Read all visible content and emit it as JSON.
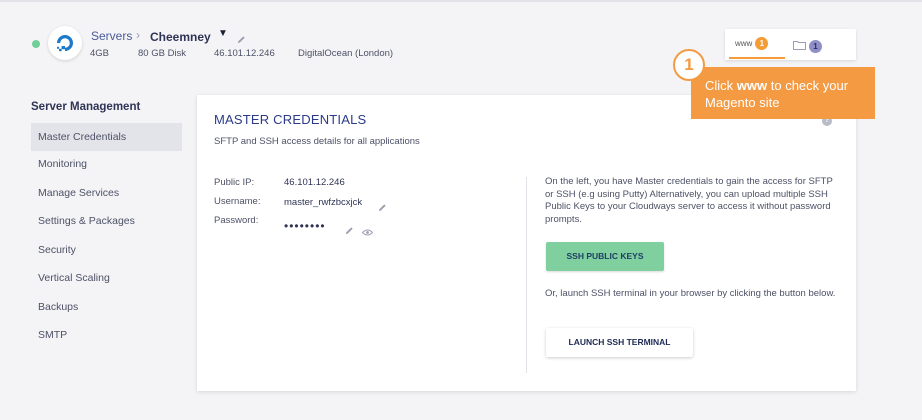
{
  "header": {
    "breadcrumb_root": "Servers",
    "breadcrumb_current": "Cheemney",
    "ram": "4GB",
    "disk": "80 GB Disk",
    "ip": "46.101.12.246",
    "provider": "DigitalOcean (London)",
    "status_color": "#6fcf97"
  },
  "quick_tabs": {
    "www_label": "www",
    "www_count": "1",
    "files_count": "1"
  },
  "callout": {
    "step": "1",
    "text_prefix": "Click ",
    "text_bold": "www",
    "text_suffix": " to check your Magento site"
  },
  "sidebar": {
    "title": "Server Management",
    "items": [
      {
        "label": "Master Credentials",
        "active": true
      },
      {
        "label": "Monitoring"
      },
      {
        "label": "Manage Services"
      },
      {
        "label": "Settings & Packages"
      },
      {
        "label": "Security"
      },
      {
        "label": "Vertical Scaling"
      },
      {
        "label": "Backups"
      },
      {
        "label": "SMTP"
      }
    ]
  },
  "card": {
    "title": "MASTER CREDENTIALS",
    "subtitle": "SFTP and SSH access details for all applications",
    "public_ip_label": "Public IP:",
    "public_ip": "46.101.12.246",
    "username_label": "Username:",
    "username": "master_rwfzbcxjck",
    "password_label": "Password:",
    "password_mask": "••••••••",
    "info_text": "On the left, you have Master credentials to gain the access for SFTP or SSH (e.g using Putty) Alternatively, you can upload multiple SSH Public Keys to your Cloudways server to access it without password prompts.",
    "ssh_keys_button": "SSH PUBLIC KEYS",
    "terminal_text": "Or, launch SSH terminal in your browser by clicking the button below.",
    "terminal_button": "LAUNCH SSH TERMINAL"
  },
  "colors": {
    "accent_orange": "#f49a42",
    "green_button": "#7fcf9f",
    "title_blue": "#2b3a8a"
  }
}
